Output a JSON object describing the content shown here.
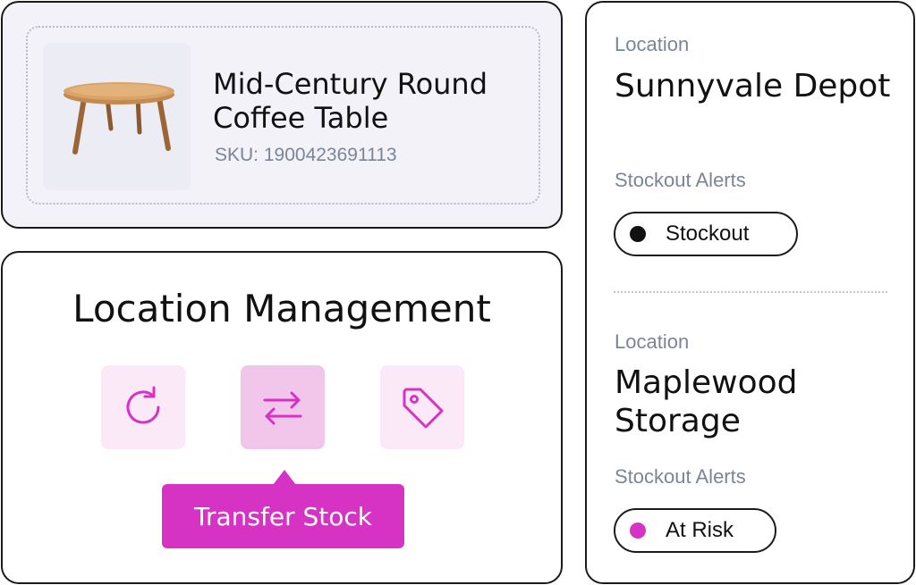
{
  "product": {
    "title": "Mid-Century Round Coffee Table",
    "sku": "SKU: 1900423691113"
  },
  "management": {
    "title": "Location Management",
    "actions": [
      {
        "icon": "refresh-icon"
      },
      {
        "icon": "transfer-arrows-icon"
      },
      {
        "icon": "tag-icon"
      }
    ],
    "tooltip": "Transfer Stock"
  },
  "locations": [
    {
      "label": "Location",
      "name": "Sunnyvale Depot",
      "alerts_label": "Stockout Alerts",
      "status": "Stockout",
      "status_color": "#111111"
    },
    {
      "label": "Location",
      "name": "Maplewood Storage",
      "alerts_label": "Stockout Alerts",
      "status": "At Risk",
      "status_color": "#d633c4"
    }
  ],
  "colors": {
    "accent": "#d633c4",
    "accent_light": "#fbe9f7",
    "accent_mid": "#f2c6eb",
    "muted_text": "#7a8596"
  }
}
